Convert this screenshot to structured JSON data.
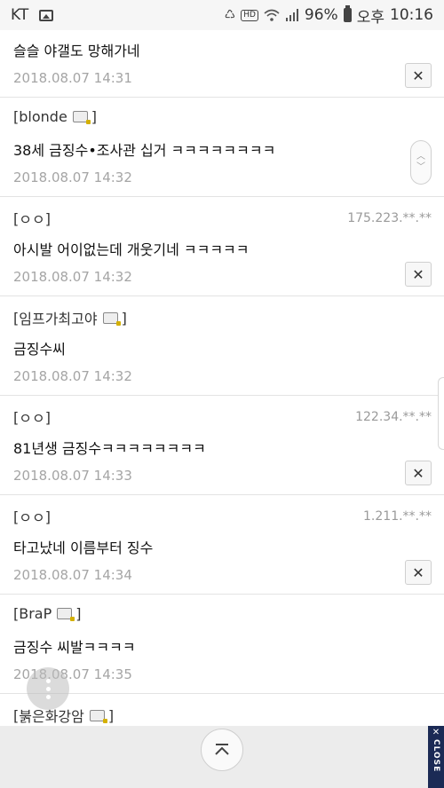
{
  "status_bar": {
    "carrier": "KT",
    "battery": "96%",
    "ampm": "오후",
    "time": "10:16",
    "hd": "HD",
    "icons": [
      "gallery-icon",
      "recycle-icon",
      "hd-icon",
      "wifi-icon",
      "signal-icon",
      "battery-icon"
    ]
  },
  "comments": [
    {
      "author": "",
      "text": "슬슬 야갤도 망해가네",
      "date": "2018.08.07 14:31",
      "ip": ""
    },
    {
      "author": "blonde",
      "text": "38세 금징수•조사관 십거 ㅋㅋㅋㅋㅋㅋㅋㅋ",
      "date": "2018.08.07 14:32",
      "ip": ""
    },
    {
      "author": "ㅇㅇ",
      "text": "아시발 어이없는데 개웃기네 ㅋㅋㅋㅋㅋ",
      "date": "2018.08.07 14:32",
      "ip": "175.223.**.**"
    },
    {
      "author": "임프가최고야",
      "text": "금징수씨",
      "date": "2018.08.07 14:32",
      "ip": ""
    },
    {
      "author": "ㅇㅇ",
      "text": "81년생 금징수ㅋㅋㅋㅋㅋㅋㅋㅋ",
      "date": "2018.08.07 14:33",
      "ip": "122.34.**.**"
    },
    {
      "author": "ㅇㅇ",
      "text": "타고났네 이름부터 징수",
      "date": "2018.08.07 14:34",
      "ip": "1.211.**.**"
    },
    {
      "author": "BraP",
      "text": "금징수 씨발ㅋㅋㅋㅋ",
      "date": "2018.08.07 14:35",
      "ip": ""
    },
    {
      "author": "붉은화강암",
      "text": "",
      "date": "",
      "ip": ""
    }
  ],
  "buttons": {
    "delete": "✕",
    "scroll_top": "scroll-to-top",
    "close_ad": "CLOSE"
  },
  "colors": {
    "close_tab": "#1b2a55"
  }
}
